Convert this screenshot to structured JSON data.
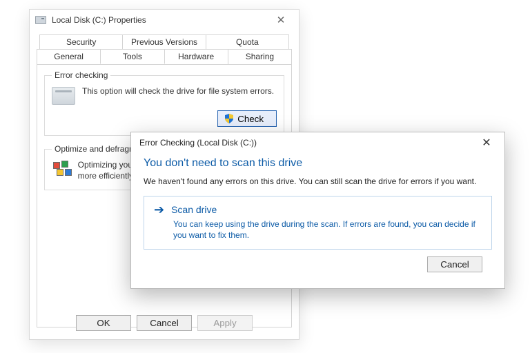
{
  "props": {
    "title": "Local Disk (C:) Properties",
    "tabs_back": [
      "Security",
      "Previous Versions",
      "Quota"
    ],
    "tabs_front": [
      "General",
      "Tools",
      "Hardware",
      "Sharing"
    ],
    "active_tab": "Tools",
    "error_checking": {
      "legend": "Error checking",
      "text": "This option will check the drive for file system errors.",
      "button": "Check"
    },
    "defrag": {
      "legend": "Optimize and defragment drive",
      "text": "Optimizing your computer's drives can help it run more efficiently…"
    },
    "buttons": {
      "ok": "OK",
      "cancel": "Cancel",
      "apply": "Apply"
    }
  },
  "dialog": {
    "title": "Error Checking (Local Disk (C:))",
    "heading": "You don't need to scan this drive",
    "message": "We haven't found any errors on this drive. You can still scan the drive for errors if you want.",
    "scan_label": "Scan drive",
    "scan_sub": "You can keep using the drive during the scan. If errors are found, you can decide if you want to fix them.",
    "cancel": "Cancel"
  }
}
